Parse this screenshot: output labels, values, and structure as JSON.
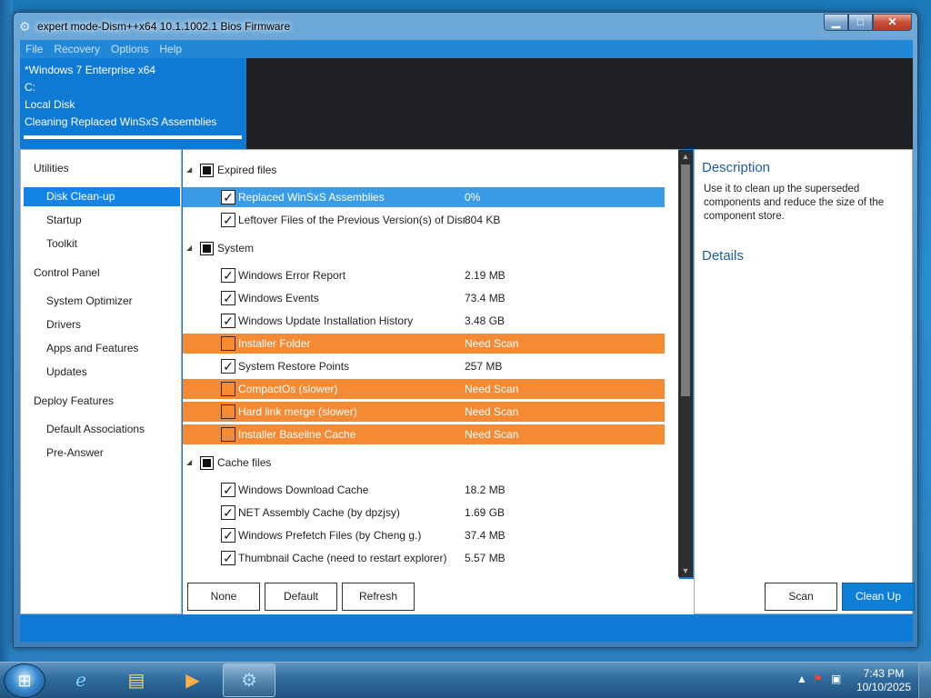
{
  "window": {
    "title": "expert mode-Dism++x64 10.1.1002.1 Bios Firmware",
    "controls": {
      "minimize": "▁",
      "maximize": "□",
      "close": "✕"
    }
  },
  "menubar": [
    "File",
    "Recovery",
    "Options",
    "Help"
  ],
  "info": {
    "os": "*Windows 7 Enterprise x64",
    "drive": "C:",
    "disk": "Local Disk",
    "task": "Cleaning Replaced WinSxS Assemblies"
  },
  "sidebar": {
    "groups": [
      {
        "label": "Utilities",
        "items": [
          "Disk Clean-up",
          "Startup",
          "Toolkit"
        ]
      },
      {
        "label": "Control Panel",
        "items": [
          "System Optimizer",
          "Drivers",
          "Apps and Features",
          "Updates"
        ]
      },
      {
        "label": "Deploy Features",
        "items": [
          "Default Associations",
          "Pre-Answer"
        ]
      }
    ],
    "active": "Disk Clean-up"
  },
  "list": {
    "groups": [
      {
        "label": "Expired files",
        "items": [
          {
            "label": "Replaced WinSxS Assemblies",
            "size": "0%",
            "checked": true,
            "state": "selected"
          },
          {
            "label": "Leftover Files of the Previous Version(s) of Dism++",
            "size": "804 KB",
            "checked": true,
            "state": "normal"
          }
        ]
      },
      {
        "label": "System",
        "items": [
          {
            "label": "Windows Error Report",
            "size": "2.19 MB",
            "checked": true,
            "state": "normal"
          },
          {
            "label": "Windows Events",
            "size": "73.4 MB",
            "checked": true,
            "state": "normal"
          },
          {
            "label": "Windows Update Installation History",
            "size": "3.48 GB",
            "checked": true,
            "state": "normal"
          },
          {
            "label": "Installer Folder",
            "size": "Need Scan",
            "checked": false,
            "state": "warning"
          },
          {
            "label": "System Restore Points",
            "size": "257 MB",
            "checked": true,
            "state": "normal"
          },
          {
            "label": "CompactOs (slower)",
            "size": "Need Scan",
            "checked": false,
            "state": "warning"
          },
          {
            "label": "Hard link merge (slower)",
            "size": "Need Scan",
            "checked": false,
            "state": "warning"
          },
          {
            "label": "Installer Baseline Cache",
            "size": "Need Scan",
            "checked": false,
            "state": "warning"
          }
        ]
      },
      {
        "label": "Cache files",
        "items": [
          {
            "label": "Windows Download Cache",
            "size": "18.2 MB",
            "checked": true,
            "state": "normal"
          },
          {
            "label": "NET Assembly Cache (by dpzjsy)",
            "size": "1.69 GB",
            "checked": true,
            "state": "normal"
          },
          {
            "label": "Windows Prefetch Files (by Cheng g.)",
            "size": "37.4 MB",
            "checked": true,
            "state": "normal"
          },
          {
            "label": "Thumbnail Cache (need to restart explorer)",
            "size": "5.57 MB",
            "checked": true,
            "state": "normal"
          }
        ]
      }
    ]
  },
  "description": {
    "title": "Description",
    "text": "Use it to clean up the superseded components and reduce the size of the component store.",
    "details_title": "Details"
  },
  "buttons": {
    "none": "None",
    "default": "Default",
    "refresh": "Refresh",
    "scan": "Scan",
    "clean_up": "Clean Up"
  },
  "taskbar": {
    "apps": [
      "internet-explorer",
      "windows-explorer",
      "media-player",
      "dism-plus-plus"
    ],
    "clock_time": "7:43 PM",
    "clock_date": "10/10/2025"
  },
  "colors": {
    "accent": "#0f7bd6",
    "selected_row": "#3a9ce6",
    "warning_row": "#f48a33",
    "dark_panel": "#1e2023"
  }
}
